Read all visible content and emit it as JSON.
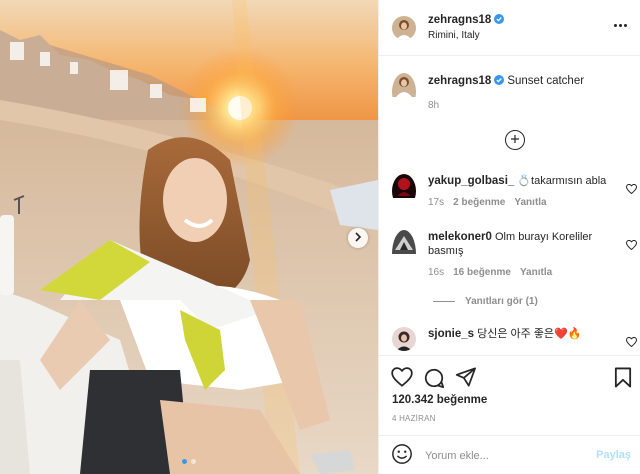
{
  "post": {
    "username": "zehragns18",
    "location": "Rimini, Italy",
    "caption": "Sunset catcher",
    "caption_time": "8h",
    "likes": "120.342 beğenme",
    "date": "4 HAZİRAN",
    "comment_placeholder": "Yorum ekle...",
    "post_button": "Paylaş",
    "view_replies": "Yanıtları gör (1)"
  },
  "comments": [
    {
      "username": "yakup_golbasi_",
      "text": "💍takarmısın abla",
      "time": "17s",
      "likes": "2 beğenme",
      "reply": "Yanıtla"
    },
    {
      "username": "melekoner0",
      "text": "Olm burayı Koreliler basmış",
      "time": "16s",
      "likes": "16 beğenme",
      "reply": "Yanıtla"
    },
    {
      "username": "sjonie_s",
      "text": "당신은 아주 좋은❤️🔥",
      "time": "",
      "likes": "",
      "reply": ""
    }
  ],
  "icons": {
    "verified": "verified-badge-icon",
    "more": "more-options-icon",
    "load_more": "plus-circle-icon",
    "heart": "heart-icon",
    "comment": "comment-icon",
    "share": "share-icon",
    "save": "bookmark-icon",
    "emoji": "emoji-icon",
    "next": "chevron-right-icon"
  },
  "colors": {
    "verified": "#3897f0",
    "link_disabled": "#b2dffc",
    "muted": "#8e8e8e",
    "text": "#262626"
  },
  "carousel": {
    "slide": 1,
    "total": 2
  }
}
